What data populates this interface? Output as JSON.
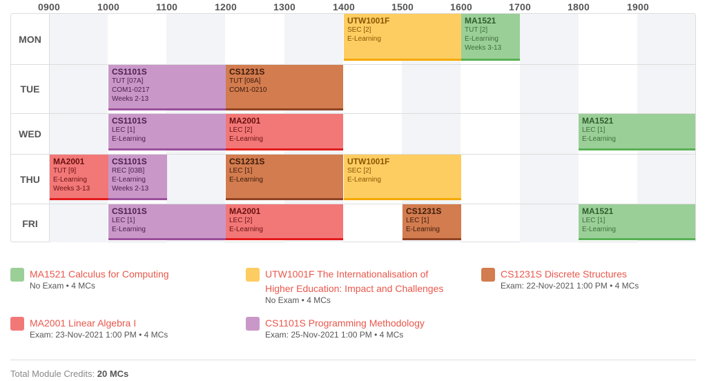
{
  "hours": [
    "0900",
    "1000",
    "1100",
    "1200",
    "1300",
    "1400",
    "1500",
    "1600",
    "1700",
    "1800",
    "1900"
  ],
  "days": [
    "MON",
    "TUE",
    "WED",
    "THU",
    "FRI"
  ],
  "lessons": {
    "mon_utw": {
      "code": "UTW1001F",
      "type": "SEC [2]",
      "venue": "E-Learning",
      "weeks": ""
    },
    "mon_ma1521": {
      "code": "MA1521",
      "type": "TUT [2]",
      "venue": "E-Learning",
      "weeks": "Weeks 3-13"
    },
    "tue_cs1101s": {
      "code": "CS1101S",
      "type": "TUT [07A]",
      "venue": "COM1-0217",
      "weeks": "Weeks 2-13"
    },
    "tue_cs1231s": {
      "code": "CS1231S",
      "type": "TUT [08A]",
      "venue": "COM1-0210",
      "weeks": ""
    },
    "wed_cs1101s": {
      "code": "CS1101S",
      "type": "LEC [1]",
      "venue": "E-Learning",
      "weeks": ""
    },
    "wed_ma2001": {
      "code": "MA2001",
      "type": "LEC [2]",
      "venue": "E-Learning",
      "weeks": ""
    },
    "wed_ma1521": {
      "code": "MA1521",
      "type": "LEC [1]",
      "venue": "E-Learning",
      "weeks": ""
    },
    "thu_ma2001": {
      "code": "MA2001",
      "type": "TUT [9]",
      "venue": "E-Learning",
      "weeks": "Weeks 3-13"
    },
    "thu_cs1101s": {
      "code": "CS1101S",
      "type": "REC [03B]",
      "venue": "E-Learning",
      "weeks": "Weeks 2-13"
    },
    "thu_cs1231s": {
      "code": "CS1231S",
      "type": "LEC [1]",
      "venue": "E-Learning",
      "weeks": ""
    },
    "thu_utw": {
      "code": "UTW1001F",
      "type": "SEC [2]",
      "venue": "E-Learning",
      "weeks": ""
    },
    "fri_cs1101s": {
      "code": "CS1101S",
      "type": "LEC [1]",
      "venue": "E-Learning",
      "weeks": ""
    },
    "fri_ma2001": {
      "code": "MA2001",
      "type": "LEC [2]",
      "venue": "E-Learning",
      "weeks": ""
    },
    "fri_cs1231s": {
      "code": "CS1231S",
      "type": "LEC [1]",
      "venue": "E-Learning",
      "weeks": ""
    },
    "fri_ma1521": {
      "code": "MA1521",
      "type": "LEC [1]",
      "venue": "E-Learning",
      "weeks": ""
    }
  },
  "modules": {
    "ma1521": {
      "title": "MA1521 Calculus for Computing",
      "info": "No Exam • 4 MCs"
    },
    "utw1001f": {
      "title_line1": "UTW1001F The Internationalisation of",
      "title_line2": "Higher Education: Impact and Challenges",
      "info": "No Exam • 4 MCs"
    },
    "cs1231s": {
      "title": "CS1231S Discrete Structures",
      "info": "Exam: 22-Nov-2021 1:00 PM • 4 MCs"
    },
    "ma2001": {
      "title": "MA2001 Linear Algebra I",
      "info": "Exam: 23-Nov-2021 1:00 PM • 4 MCs"
    },
    "cs1101s": {
      "title": "CS1101S Programming Methodology",
      "info": "Exam: 25-Nov-2021 1:00 PM • 4 MCs"
    }
  },
  "colors": {
    "green": "#9bcf98",
    "yellow": "#fdcd62",
    "orange": "#d27c4f",
    "red": "#f27878",
    "purple": "#c998c9",
    "link": "#e8574b"
  },
  "footer": {
    "label": "Total Module Credits:",
    "value": "20 MCs"
  }
}
